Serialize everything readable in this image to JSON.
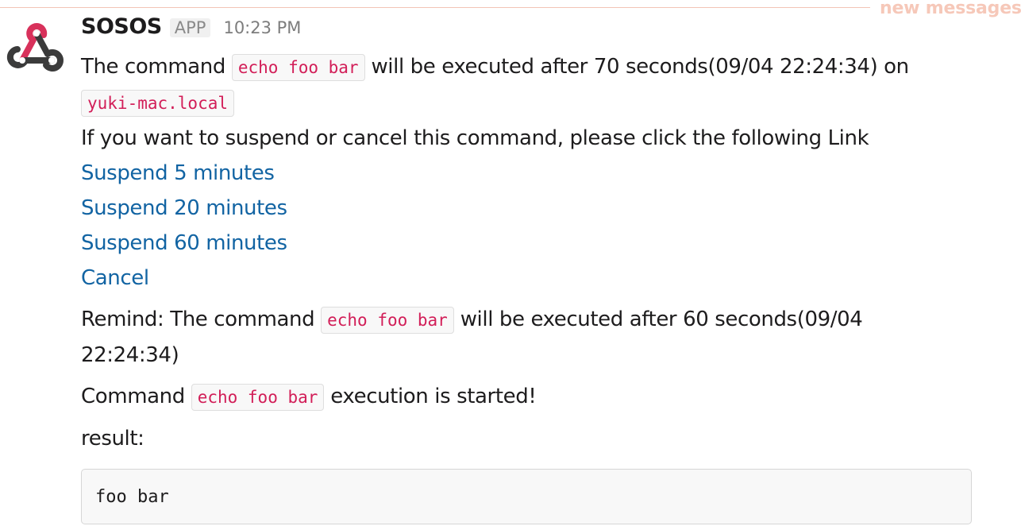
{
  "divider": {
    "label": "new messages"
  },
  "message": {
    "sender": "SOSOS",
    "badge": "APP",
    "time": "10:23 PM",
    "avatar_icon": "webhook-icon",
    "line1": {
      "prefix": "The command ",
      "code": "echo foo bar",
      "suffix": " will be executed after 70 seconds(09/04 22:24:34) on"
    },
    "host": "yuki-mac.local",
    "instruction": "If you want to suspend or cancel this command, please click the following Link",
    "links": {
      "suspend5": "Suspend 5 minutes",
      "suspend20": "Suspend 20 minutes",
      "suspend60": "Suspend 60 minutes",
      "cancel": "Cancel"
    },
    "remind": {
      "prefix": "Remind: The command ",
      "code": "echo foo bar",
      "suffix": " will be executed after 60 seconds(09/04",
      "suffix2": "22:24:34)"
    },
    "started": {
      "prefix": "Command ",
      "code": "echo foo bar",
      "suffix": " execution is started!"
    },
    "result_label": "result:",
    "result_output": "foo bar"
  },
  "colors": {
    "accent_pink": "#d8315b",
    "link": "#1264a3",
    "code_text": "#d21e58",
    "divider": "#f2c4b6"
  }
}
